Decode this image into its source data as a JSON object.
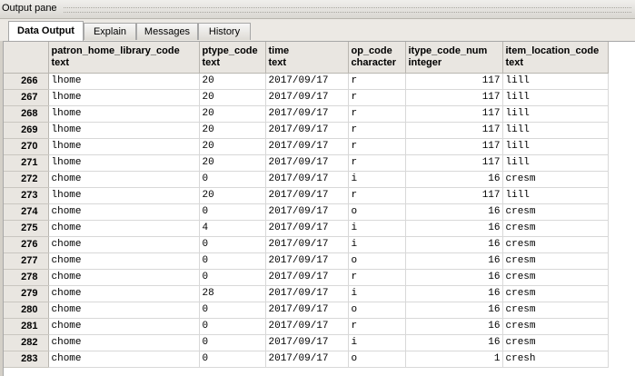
{
  "window": {
    "title": "Output pane"
  },
  "tabs": [
    {
      "label": "Data Output",
      "active": true
    },
    {
      "label": "Explain",
      "active": false
    },
    {
      "label": "Messages",
      "active": false
    },
    {
      "label": "History",
      "active": false
    }
  ],
  "grid": {
    "columns": [
      {
        "name": "patron_home_library_code",
        "type": "text"
      },
      {
        "name": "ptype_code",
        "type": "text"
      },
      {
        "name": "time",
        "type": "text"
      },
      {
        "name": "op_code",
        "type": "character"
      },
      {
        "name": "itype_code_num",
        "type": "integer"
      },
      {
        "name": "item_location_code",
        "type": "text"
      }
    ],
    "rows": [
      {
        "n": "266",
        "cells": [
          "lhome",
          "20",
          "2017/09/17",
          "r",
          "117",
          "lill"
        ]
      },
      {
        "n": "267",
        "cells": [
          "lhome",
          "20",
          "2017/09/17",
          "r",
          "117",
          "lill"
        ]
      },
      {
        "n": "268",
        "cells": [
          "lhome",
          "20",
          "2017/09/17",
          "r",
          "117",
          "lill"
        ]
      },
      {
        "n": "269",
        "cells": [
          "lhome",
          "20",
          "2017/09/17",
          "r",
          "117",
          "lill"
        ]
      },
      {
        "n": "270",
        "cells": [
          "lhome",
          "20",
          "2017/09/17",
          "r",
          "117",
          "lill"
        ]
      },
      {
        "n": "271",
        "cells": [
          "lhome",
          "20",
          "2017/09/17",
          "r",
          "117",
          "lill"
        ]
      },
      {
        "n": "272",
        "cells": [
          "chome",
          "0",
          "2017/09/17",
          "i",
          "16",
          "cresm"
        ]
      },
      {
        "n": "273",
        "cells": [
          "lhome",
          "20",
          "2017/09/17",
          "r",
          "117",
          "lill"
        ]
      },
      {
        "n": "274",
        "cells": [
          "chome",
          "0",
          "2017/09/17",
          "o",
          "16",
          "cresm"
        ]
      },
      {
        "n": "275",
        "cells": [
          "chome",
          "4",
          "2017/09/17",
          "i",
          "16",
          "cresm"
        ]
      },
      {
        "n": "276",
        "cells": [
          "chome",
          "0",
          "2017/09/17",
          "i",
          "16",
          "cresm"
        ]
      },
      {
        "n": "277",
        "cells": [
          "chome",
          "0",
          "2017/09/17",
          "o",
          "16",
          "cresm"
        ]
      },
      {
        "n": "278",
        "cells": [
          "chome",
          "0",
          "2017/09/17",
          "r",
          "16",
          "cresm"
        ]
      },
      {
        "n": "279",
        "cells": [
          "chome",
          "28",
          "2017/09/17",
          "i",
          "16",
          "cresm"
        ]
      },
      {
        "n": "280",
        "cells": [
          "chome",
          "0",
          "2017/09/17",
          "o",
          "16",
          "cresm"
        ]
      },
      {
        "n": "281",
        "cells": [
          "chome",
          "0",
          "2017/09/17",
          "r",
          "16",
          "cresm"
        ]
      },
      {
        "n": "282",
        "cells": [
          "chome",
          "0",
          "2017/09/17",
          "i",
          "16",
          "cresm"
        ]
      },
      {
        "n": "283",
        "cells": [
          "chome",
          "0",
          "2017/09/17",
          "o",
          "1",
          "cresh"
        ]
      }
    ]
  }
}
